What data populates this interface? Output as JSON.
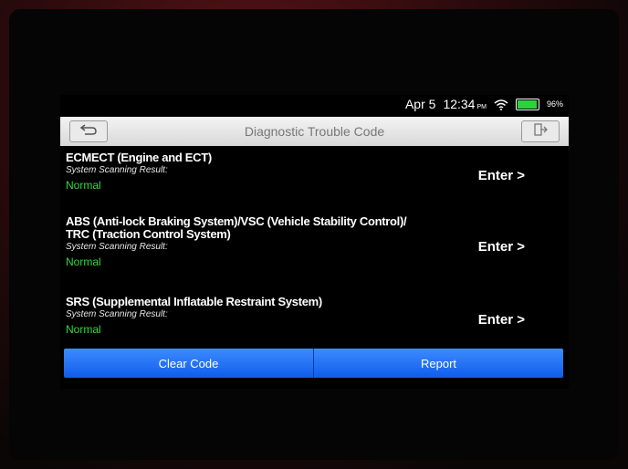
{
  "status": {
    "date": "Apr 5",
    "time": "12:34",
    "ampm": "PM",
    "battery": "96%"
  },
  "header": {
    "title": "Diagnostic Trouble Code"
  },
  "systems": [
    {
      "name_lines": [
        "ECMECT (Engine and ECT)"
      ],
      "label": "System Scanning Result:",
      "status": "Normal",
      "enter_label": "Enter >"
    },
    {
      "name_lines": [
        "ABS (Anti-lock Braking System)/VSC (Vehicle Stability Control)/",
        "TRC (Traction Control System)"
      ],
      "label": "System Scanning Result:",
      "status": "Normal",
      "enter_label": "Enter >"
    },
    {
      "name_lines": [
        "SRS (Supplemental Inflatable Restraint System)"
      ],
      "label": "System Scanning Result:",
      "status": "Normal",
      "enter_label": "Enter >"
    }
  ],
  "footer": {
    "clear_label": "Clear Code",
    "report_label": "Report"
  },
  "colors": {
    "status_normal": "#38d63e",
    "button_bar": "#1a6cf2",
    "battery": "#2ad33c"
  },
  "icons": {
    "back": "back-arrow-icon",
    "exit": "exit-icon",
    "wifi": "wifi-icon",
    "battery": "battery-icon"
  }
}
